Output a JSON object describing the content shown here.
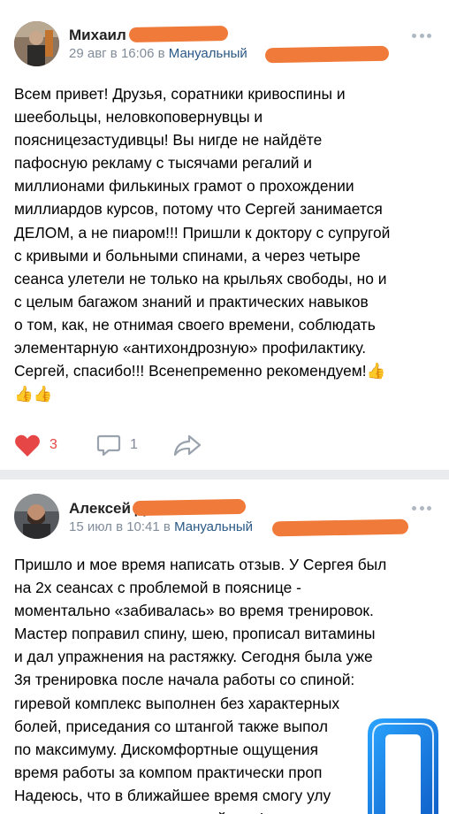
{
  "posts": [
    {
      "author": "Михаил М",
      "date": "29 авг в 16:06 в",
      "group": "Мануальный",
      "text": "Всем привет! Друзья, соратники кривоспины и\nшеебольцы, неловкоповернувцы и\nпоясницезастудивцы! Вы нигде не найдёте\nпафосную рекламу с тысячами регалий и\nмиллионами филькиных грамот о прохождении\nмиллиардов курсов, потому что Сергей занимается\nДЕЛОМ, а не пиаром!!! Пришли к доктору с супругой\nс кривыми и больными спинами, а через четыре\nсеанса улетели не только на крыльях свободы, но и\nс целым багажом знаний и практических навыков\nо том, как, не отнимая своего времени, соблюдать\nэлементарную «антихондрозную» профилактику.\nСергей, спасибо!!! Всенепременно рекомендуем!👍\n👍👍",
      "likes": "3",
      "comments": "1"
    },
    {
      "author": "Алексей Д",
      "date": "15 июл в 10:41 в",
      "group": "Мануальный",
      "text": "Пришло и мое время написать отзыв. У Сергея был\nна 2х сеансах с проблемой в пояснице -\nмоментально «забивалась» во время тренировок.\nМастер поправил спину, шею, прописал витамины\nи дал упражнения на растяжку. Сегодня была уже\n3я тренировка после начала работы со спиной:\nгиревой комплекс выполнен без характерных\nболей, приседания со штангой также выпол\nпо максимуму. Дискомфортные ощущения\nвремя работы за компом практически проп\nНадеюсь, что в ближайшее время смогу улу\nсвои показатели и в становой тяге!"
    }
  ],
  "icons": {
    "like": "heart-icon",
    "comment": "comment-icon",
    "share": "share-icon",
    "more": "more-icon"
  },
  "colors": {
    "like": "#e64646",
    "link": "#2a5885",
    "meta": "#818c99",
    "redaction": "#f07a3a",
    "logo": "#1e7fe0"
  }
}
